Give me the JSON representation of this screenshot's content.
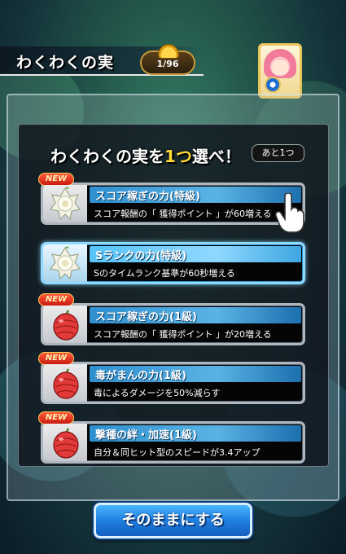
{
  "header": {
    "title": "わくわくの実",
    "counter": "1/96"
  },
  "prompt": {
    "before": "わくわくの実を",
    "highlight": "1つ",
    "after": "選べ！",
    "remaining": "あと1つ"
  },
  "options": [
    {
      "new": "NEW",
      "title": "スコア稼ぎの力(特級)",
      "description": "スコア報酬の「 獲得ポイント 」が60増える",
      "fruit": "white-fruit-icon",
      "selected": false
    },
    {
      "new": "",
      "title": "Sランクの力(特級)",
      "description": "Sのタイムランク基準が60秒増える",
      "fruit": "white-fruit-icon",
      "selected": true
    },
    {
      "new": "NEW",
      "title": "スコア稼ぎの力(1級)",
      "description": "スコア報酬の「 獲得ポイント 」が20増える",
      "fruit": "red-fruit-icon",
      "selected": false
    },
    {
      "new": "NEW",
      "title": "毒がまんの力(1級)",
      "description": "毒によるダメージを50%減らす",
      "fruit": "red-fruit-icon",
      "selected": false
    },
    {
      "new": "NEW",
      "title": "撃種の絆・加速(1級)",
      "description": "自分＆同ヒット型のスピードが3.4アップ",
      "fruit": "red-fruit-icon",
      "selected": false
    }
  ],
  "confirm_label": "そのままにする",
  "colors": {
    "title_bar": "#5ab3e4",
    "selected_border": "#8fd8ff",
    "new_badge": "#e0301c",
    "confirm_button": "#1f7fe0",
    "highlight_text": "#ffd93a"
  }
}
